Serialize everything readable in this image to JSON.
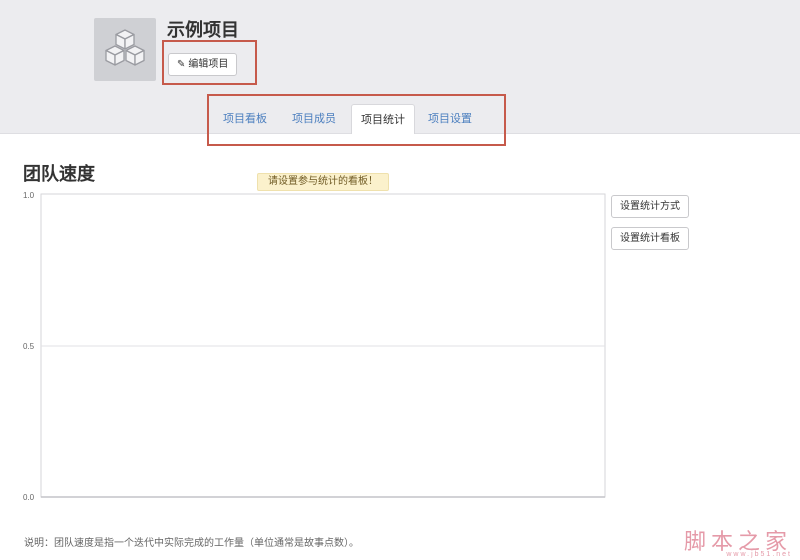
{
  "project": {
    "title": "示例项目",
    "edit_label": "编辑项目",
    "logo_icon": "cubes-icon"
  },
  "tabs": [
    {
      "label": "项目看板",
      "active": false
    },
    {
      "label": "项目成员",
      "active": false
    },
    {
      "label": "项目统计",
      "active": true
    },
    {
      "label": "项目设置",
      "active": false
    }
  ],
  "section": {
    "title": "团队速度",
    "notice": "请设置参与统计的看板！"
  },
  "buttons": {
    "set_method": "设置统计方式",
    "set_board": "设置统计看板"
  },
  "chart_data": {
    "type": "line",
    "series": [],
    "ylim": [
      0.0,
      1.0
    ],
    "yticks": [
      "1.0",
      "0.5",
      "0.0"
    ],
    "grid": true
  },
  "footnote": "说明：团队速度是指一个迭代中实际完成的工作量（单位通常是故事点数）。",
  "watermark": {
    "text": "脚本之家",
    "url": "www.jb51.net"
  },
  "colors": {
    "header_bg": "#ececef",
    "link": "#4c7fbf",
    "highlight": "#c65a4b",
    "notice_bg": "#fbf1cc"
  }
}
